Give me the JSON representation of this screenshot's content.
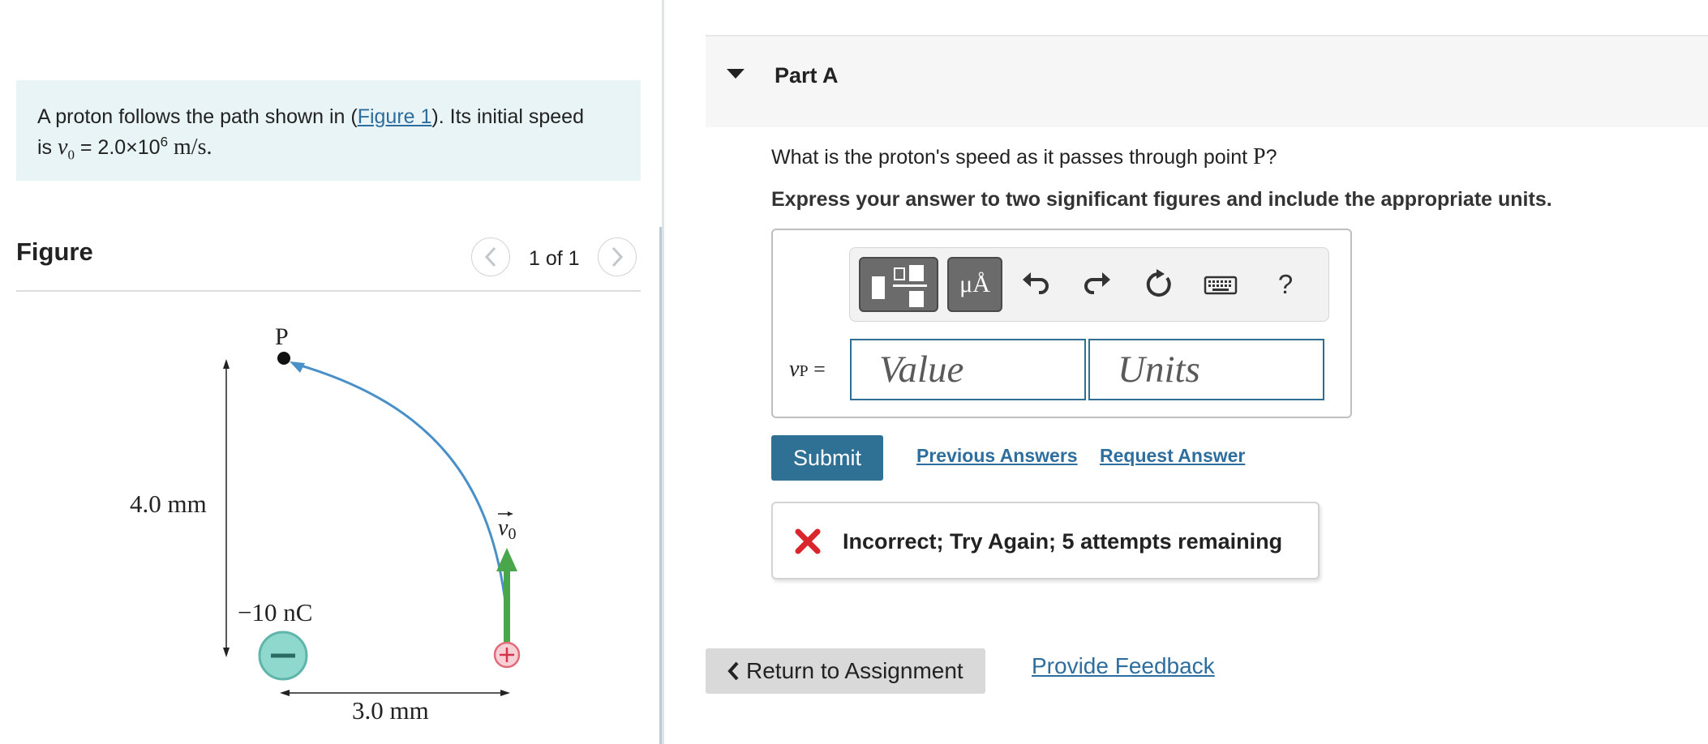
{
  "problem": {
    "text_before_link": "A proton follows the path shown in (",
    "figure_link": "Figure 1",
    "text_after_link": "). Its initial speed",
    "line2_prefix": "is ",
    "v_symbol": "v",
    "v_subscript": "0",
    "equals": " = 2.0×10",
    "exponent": "6",
    "unit": "m/s."
  },
  "figure": {
    "title": "Figure",
    "counter": "1 of 1",
    "labels": {
      "point": "P",
      "height": "4.0 mm",
      "charge": "−10 nC",
      "width": "3.0 mm",
      "velocity": "v",
      "velocity_sub": "0"
    },
    "colors": {
      "path": "#4a90c8",
      "arrow": "#4aa64a",
      "negative_charge": "#7ccfc4",
      "positive_charge": "#e06a7a"
    }
  },
  "part": {
    "title": "Part A",
    "question_before": "What is the proton's speed as it passes through point ",
    "question_point": "P",
    "question_after": "?",
    "instruction": "Express your answer to two significant figures and include the appropriate units."
  },
  "answer": {
    "var_symbol": "v",
    "var_subscript": "P",
    "var_equals": " =",
    "value_placeholder": "Value",
    "units_placeholder": "Units",
    "units_button": "μÅ",
    "help": "?"
  },
  "actions": {
    "submit": "Submit",
    "previous_answers": "Previous Answers",
    "request_answer": "Request Answer"
  },
  "feedback": {
    "message": "Incorrect; Try Again; 5 attempts remaining",
    "color": "#d9262c"
  },
  "footer": {
    "return": "Return to Assignment",
    "provide_feedback": "Provide Feedback"
  }
}
